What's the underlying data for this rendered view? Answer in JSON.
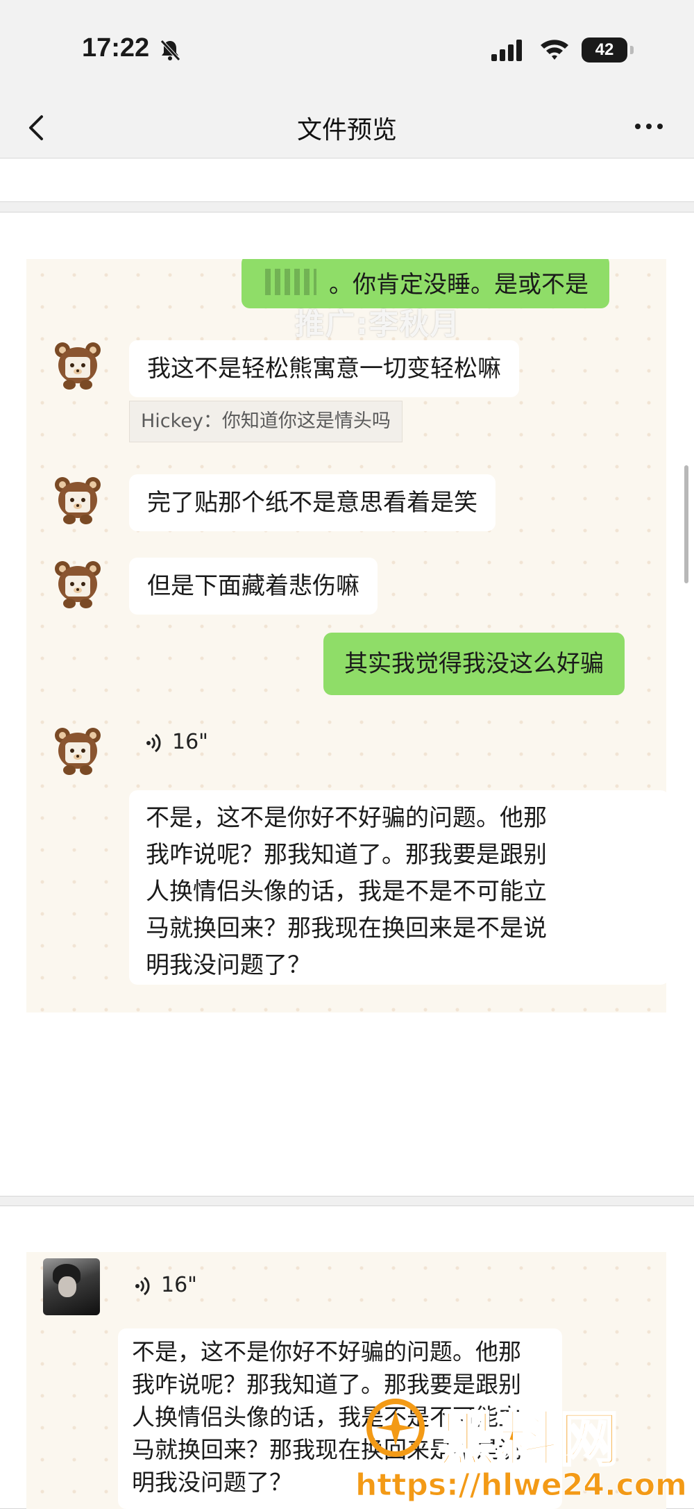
{
  "status_bar": {
    "time": "17:22",
    "battery": "42"
  },
  "nav": {
    "title": "文件预览"
  },
  "page1": {
    "top_bubble": "。你肯定没睡。是或不是",
    "promo_watermark": "推广:李秋月",
    "messages": [
      {
        "text": "我这不是轻松熊寓意一切变轻松嘛"
      },
      {
        "quote": "Hickey：你知道你这是情头吗"
      },
      {
        "text": "完了贴那个纸不是意思看着是笑"
      },
      {
        "text": "但是下面藏着悲伤嘛"
      },
      {
        "text": "其实我觉得我没这么好骗"
      },
      {
        "voice": "16\""
      }
    ],
    "transcript": [
      "不是，这不是你好不好骗的问题。他那",
      "我咋说呢？那我知道了。那我要是跟别",
      "人换情侣头像的话，我是不是不可能立",
      "马就换回来？那我现在换回来是不是说",
      "明我没问题了？"
    ]
  },
  "page2": {
    "voice": "16\"",
    "transcript": [
      "不是，这不是你好不好骗的问题。他那",
      "我咋说呢？那我知道了。那我要是跟别",
      "人换情侣头像的话，我是不是不可能立",
      "马就换回来？那我现在换回来是不是说",
      "明我没问题了？"
    ]
  },
  "watermark": {
    "logo": "黑料网",
    "url": "https://hlwe24.com"
  },
  "colors": {
    "outgoing_bubble": "#8fdd68",
    "chat_bg": "#fbf7ef",
    "watermark": "#f39a16"
  }
}
